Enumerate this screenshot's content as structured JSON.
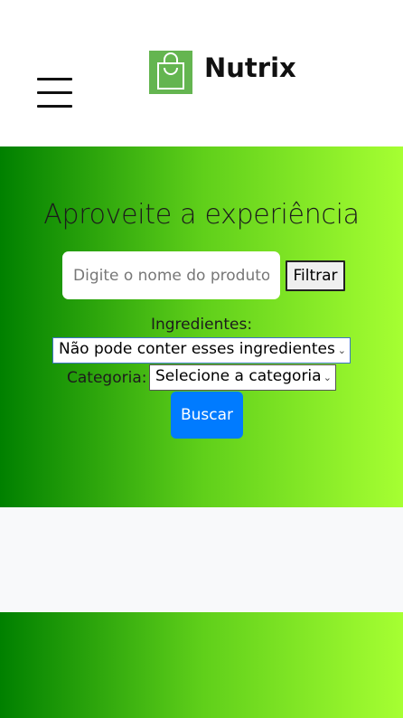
{
  "navbar": {
    "brand_name": "Nutrix",
    "menu_icon": "hamburger-menu-icon",
    "logo_icon": "shopping-bag-icon",
    "logo_color": "#64b550"
  },
  "hero": {
    "title": "Aproveite a experiência",
    "search": {
      "placeholder": "Digite o nome do produto",
      "value": ""
    },
    "filter_button": "Filtrar",
    "ingredients_label": "Ingredientes:",
    "ingredients_select": "Não pode conter esses ingredientes",
    "category_label": "Categoria:",
    "category_select": "Selecione a categoria",
    "search_button": "Buscar",
    "gradient_colors": [
      "#008000",
      "#a6ff32"
    ],
    "button_color": "#007bff"
  }
}
